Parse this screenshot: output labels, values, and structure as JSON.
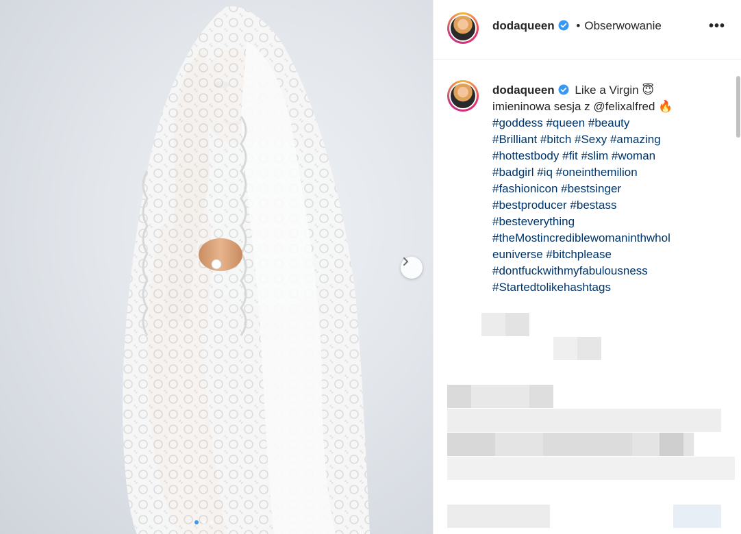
{
  "post": {
    "slide_count": 3,
    "active_slide": 0
  },
  "header": {
    "username": "dodaqueen",
    "separator": "•",
    "follow_label": "Obserwowanie",
    "more_label": "•••"
  },
  "caption": {
    "username": "dodaqueen",
    "lines": [
      {
        "text": "Like a Virgin 😇",
        "type": "text"
      },
      {
        "text": "imieninowa sesja z @felixalfred 🔥",
        "type": "text"
      },
      {
        "text": "#goddess #queen #beauty",
        "type": "tag"
      },
      {
        "text": "#Brilliant #bitch #Sexy #amazing",
        "type": "tag"
      },
      {
        "text": "#hottestbody #fit #slim #woman",
        "type": "tag"
      },
      {
        "text": "#badgirl #iq #oneinthemilion",
        "type": "tag"
      },
      {
        "text": "#fashionicon #bestsinger",
        "type": "tag"
      },
      {
        "text": "#bestproducer #bestass",
        "type": "tag"
      },
      {
        "text": "#besteverything",
        "type": "tag"
      },
      {
        "text": "#theMostincrediblewomaninthwhol",
        "type": "tag"
      },
      {
        "text": "euniverse #bitchplease",
        "type": "tag"
      },
      {
        "text": "#dontfuckwithmyfabulousness",
        "type": "tag"
      },
      {
        "text": "#Startedtolikehashtags",
        "type": "tag"
      }
    ]
  },
  "colors": {
    "accent": "#3897f0",
    "hashtag": "#003569",
    "text": "#262626"
  },
  "icons": {
    "verified": "verified-badge-icon",
    "next": "chevron-right-icon",
    "more": "more-options-icon"
  }
}
